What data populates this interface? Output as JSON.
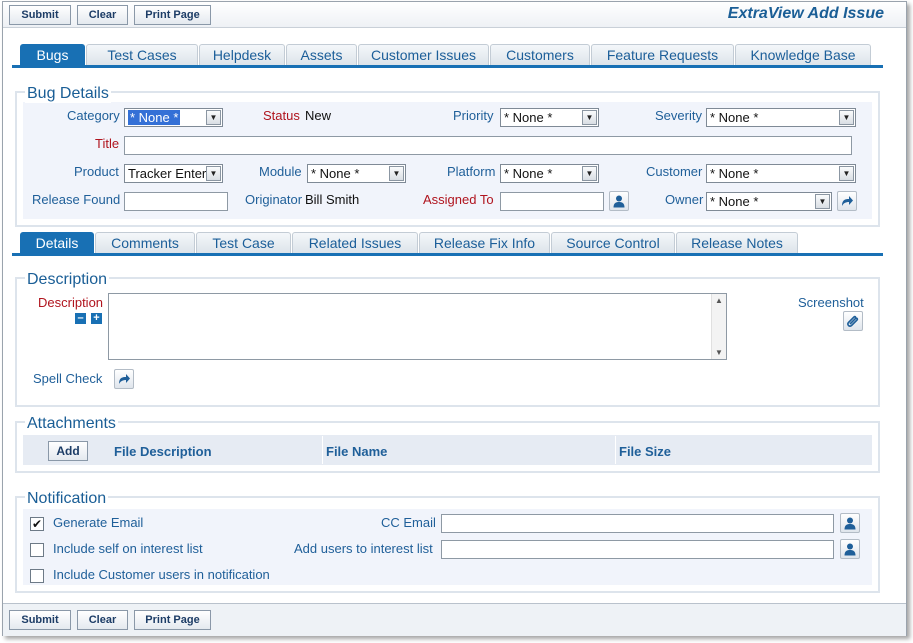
{
  "toolbar": {
    "submit_label": "Submit",
    "clear_label": "Clear",
    "print_label": "Print Page"
  },
  "app": {
    "title": "ExtraView Add Issue"
  },
  "main_tabs": [
    {
      "label": "Bugs",
      "active": true
    },
    {
      "label": "Test Cases"
    },
    {
      "label": "Helpdesk"
    },
    {
      "label": "Assets"
    },
    {
      "label": "Customer Issues"
    },
    {
      "label": "Customers"
    },
    {
      "label": "Feature Requests"
    },
    {
      "label": "Knowledge Base"
    }
  ],
  "bug_details": {
    "legend": "Bug Details",
    "category": {
      "label": "Category",
      "value": "* None *"
    },
    "status": {
      "label": "Status",
      "value": "New"
    },
    "priority": {
      "label": "Priority",
      "value": "* None *"
    },
    "severity": {
      "label": "Severity",
      "value": "* None *"
    },
    "title": {
      "label": "Title",
      "value": ""
    },
    "product": {
      "label": "Product",
      "value": "Tracker Enter"
    },
    "module": {
      "label": "Module",
      "value": "* None *"
    },
    "platform": {
      "label": "Platform",
      "value": "* None *"
    },
    "customer": {
      "label": "Customer",
      "value": "* None *"
    },
    "release_found": {
      "label": "Release Found",
      "value": ""
    },
    "originator": {
      "label": "Originator",
      "value": "Bill Smith"
    },
    "assigned_to": {
      "label": "Assigned To",
      "value": ""
    },
    "owner": {
      "label": "Owner",
      "value": "* None *"
    }
  },
  "detail_tabs": [
    {
      "label": "Details",
      "active": true
    },
    {
      "label": "Comments"
    },
    {
      "label": "Test Case"
    },
    {
      "label": "Related Issues"
    },
    {
      "label": "Release Fix Info"
    },
    {
      "label": "Source Control"
    },
    {
      "label": "Release Notes"
    }
  ],
  "description": {
    "legend": "Description",
    "label": "Description",
    "value": "",
    "screenshot_label": "Screenshot",
    "spell_check_label": "Spell Check"
  },
  "attachments": {
    "legend": "Attachments",
    "add_label": "Add",
    "columns": [
      "File Description",
      "File Name",
      "File Size"
    ]
  },
  "notification": {
    "legend": "Notification",
    "generate_email": {
      "label": "Generate Email",
      "checked": true
    },
    "include_self": {
      "label": "Include self on interest list",
      "checked": false
    },
    "include_customer": {
      "label": "Include Customer users in notification",
      "checked": false
    },
    "cc_email": {
      "label": "CC Email",
      "value": ""
    },
    "add_users": {
      "label": "Add users to interest list",
      "value": ""
    }
  },
  "icons": {
    "user_lookup": "user-icon",
    "forward": "forward-arrow-icon",
    "paperclip": "paperclip-icon",
    "collapse": "minus-icon",
    "expand": "plus-icon",
    "check": "✔"
  },
  "colors": {
    "accent": "#1870b4",
    "label": "#1f5f99",
    "required": "#b0141e",
    "section_fill": "#f1f4fb"
  }
}
